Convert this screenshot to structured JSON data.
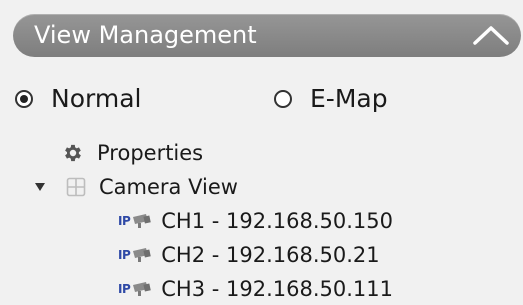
{
  "panel": {
    "title": "View Management",
    "toggle_icon": "chevron-up-icon"
  },
  "view_mode": {
    "options": [
      {
        "label": "Normal",
        "selected": true
      },
      {
        "label": "E-Map",
        "selected": false
      }
    ]
  },
  "tree": {
    "properties": {
      "label": "Properties",
      "icon": "gear-icon"
    },
    "camera_view": {
      "label": "Camera View",
      "icon": "grid-icon",
      "expanded": true
    },
    "channels": [
      {
        "badge": "IP",
        "label": "CH1 - 192.168.50.150"
      },
      {
        "badge": "IP",
        "label": "CH2 - 192.168.50.21"
      },
      {
        "badge": "IP",
        "label": "CH3 - 192.168.50.111"
      }
    ]
  },
  "colors": {
    "header_bg": "#8a8a8a",
    "panel_bg": "#f1f1f1",
    "ip_badge": "#2f49a6"
  }
}
